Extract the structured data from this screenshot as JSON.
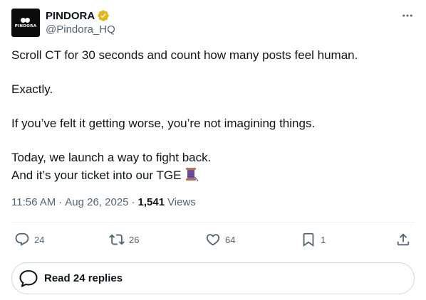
{
  "author": {
    "display_name": "PINDORA",
    "handle": "@Pindora_HQ",
    "avatar_text": "PINDORA",
    "verified": true,
    "verified_color": "#e2b719"
  },
  "post": {
    "paragraphs": [
      [
        "Scroll CT for 30 seconds and count how many posts feel human."
      ],
      [
        "Exactly."
      ],
      [
        "If you’ve felt it getting worse, you’re not imagining things."
      ],
      [
        "Today, we launch a way to fight back.",
        "And it’s your ticket into our TGE"
      ]
    ],
    "trailing_emoji_icon": "thread-spool-icon",
    "time": "11:56 AM",
    "date": "Aug 26, 2025",
    "views_count": "1,541",
    "views_label": "Views"
  },
  "actions": {
    "replies": "24",
    "reposts": "26",
    "likes": "64",
    "bookmarks": "1"
  },
  "replies_button": {
    "label": "Read 24 replies"
  },
  "colors": {
    "text": "#0f1419",
    "secondary": "#536471",
    "border": "#cfd9de"
  }
}
